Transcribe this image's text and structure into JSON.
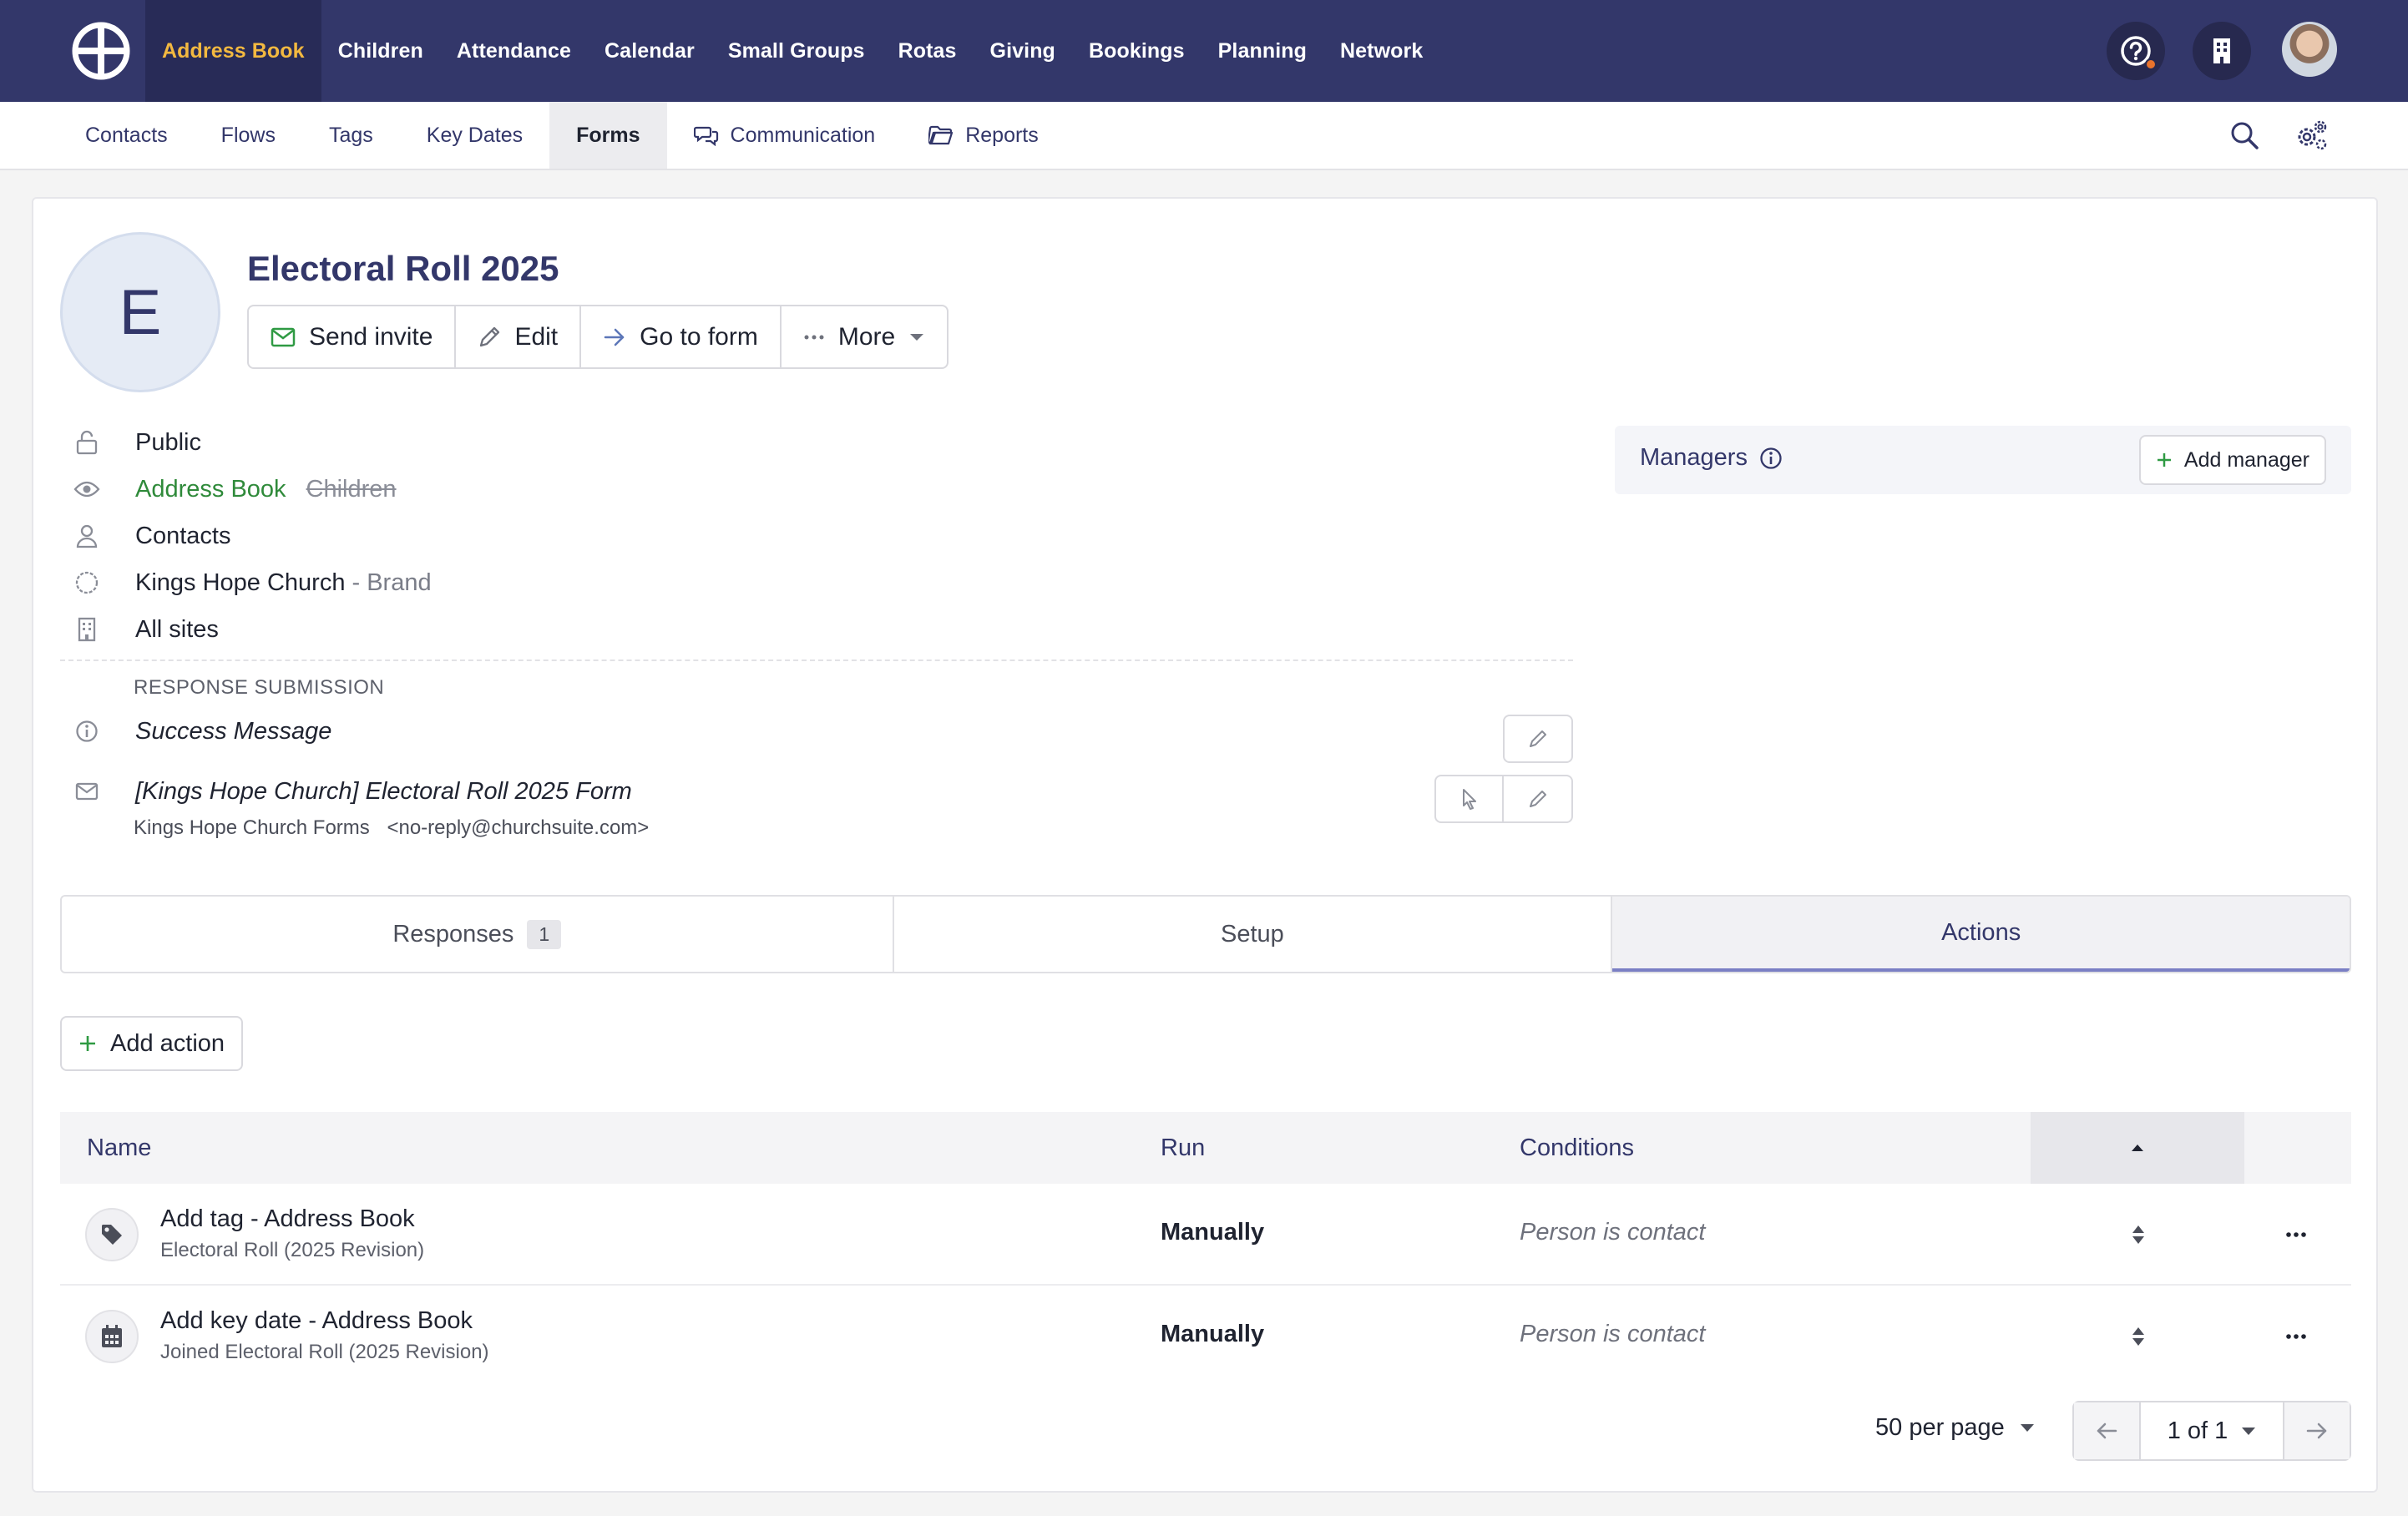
{
  "topnav": {
    "items": [
      {
        "label": "Address Book",
        "active": true
      },
      {
        "label": "Children"
      },
      {
        "label": "Attendance"
      },
      {
        "label": "Calendar"
      },
      {
        "label": "Small Groups"
      },
      {
        "label": "Rotas"
      },
      {
        "label": "Giving"
      },
      {
        "label": "Bookings"
      },
      {
        "label": "Planning"
      },
      {
        "label": "Network"
      }
    ],
    "icons": [
      "help-icon",
      "building-icon",
      "avatar"
    ],
    "accent": "#f3b940",
    "background": "#33376a"
  },
  "subnav": {
    "items": [
      {
        "label": "Contacts"
      },
      {
        "label": "Flows"
      },
      {
        "label": "Tags"
      },
      {
        "label": "Key Dates"
      },
      {
        "label": "Forms",
        "active": true
      },
      {
        "label": "Communication",
        "icon": "chat-icon"
      },
      {
        "label": "Reports",
        "icon": "folder-icon"
      }
    ]
  },
  "form": {
    "initial": "E",
    "title": "Electoral Roll 2025",
    "actions": {
      "send_invite": "Send invite",
      "edit": "Edit",
      "go_to_form": "Go to form",
      "more": "More"
    },
    "visibility": "Public",
    "modules": {
      "enabled": "Address Book",
      "disabled": "Children"
    },
    "audience": "Contacts",
    "brand_name": "Kings Hope Church",
    "brand_suffix": "- Brand",
    "sites": "All sites",
    "response_submission": {
      "label": "RESPONSE SUBMISSION",
      "success_message": "Success Message",
      "email_subject": "[Kings Hope Church] Electoral Roll 2025 Form",
      "sender_name": "Kings Hope Church Forms",
      "sender_email": "<no-reply@churchsuite.com>"
    }
  },
  "managers": {
    "label": "Managers",
    "add_label": "Add manager"
  },
  "tabs": [
    {
      "label": "Responses",
      "badge": "1"
    },
    {
      "label": "Setup"
    },
    {
      "label": "Actions",
      "active": true
    }
  ],
  "add_action_label": "Add action",
  "table": {
    "headers": {
      "name": "Name",
      "run": "Run",
      "conditions": "Conditions"
    },
    "rows": [
      {
        "icon": "tag-icon",
        "name": "Add tag - Address Book",
        "sub": "Electoral Roll (2025 Revision)",
        "run": "Manually",
        "conditions": "Person is contact"
      },
      {
        "icon": "calendar-icon",
        "name": "Add key date - Address Book",
        "sub": "Joined Electoral Roll (2025 Revision)",
        "run": "Manually",
        "conditions": "Person is contact"
      }
    ]
  },
  "pagination": {
    "per_page": "50 per page",
    "page": "1 of 1"
  }
}
